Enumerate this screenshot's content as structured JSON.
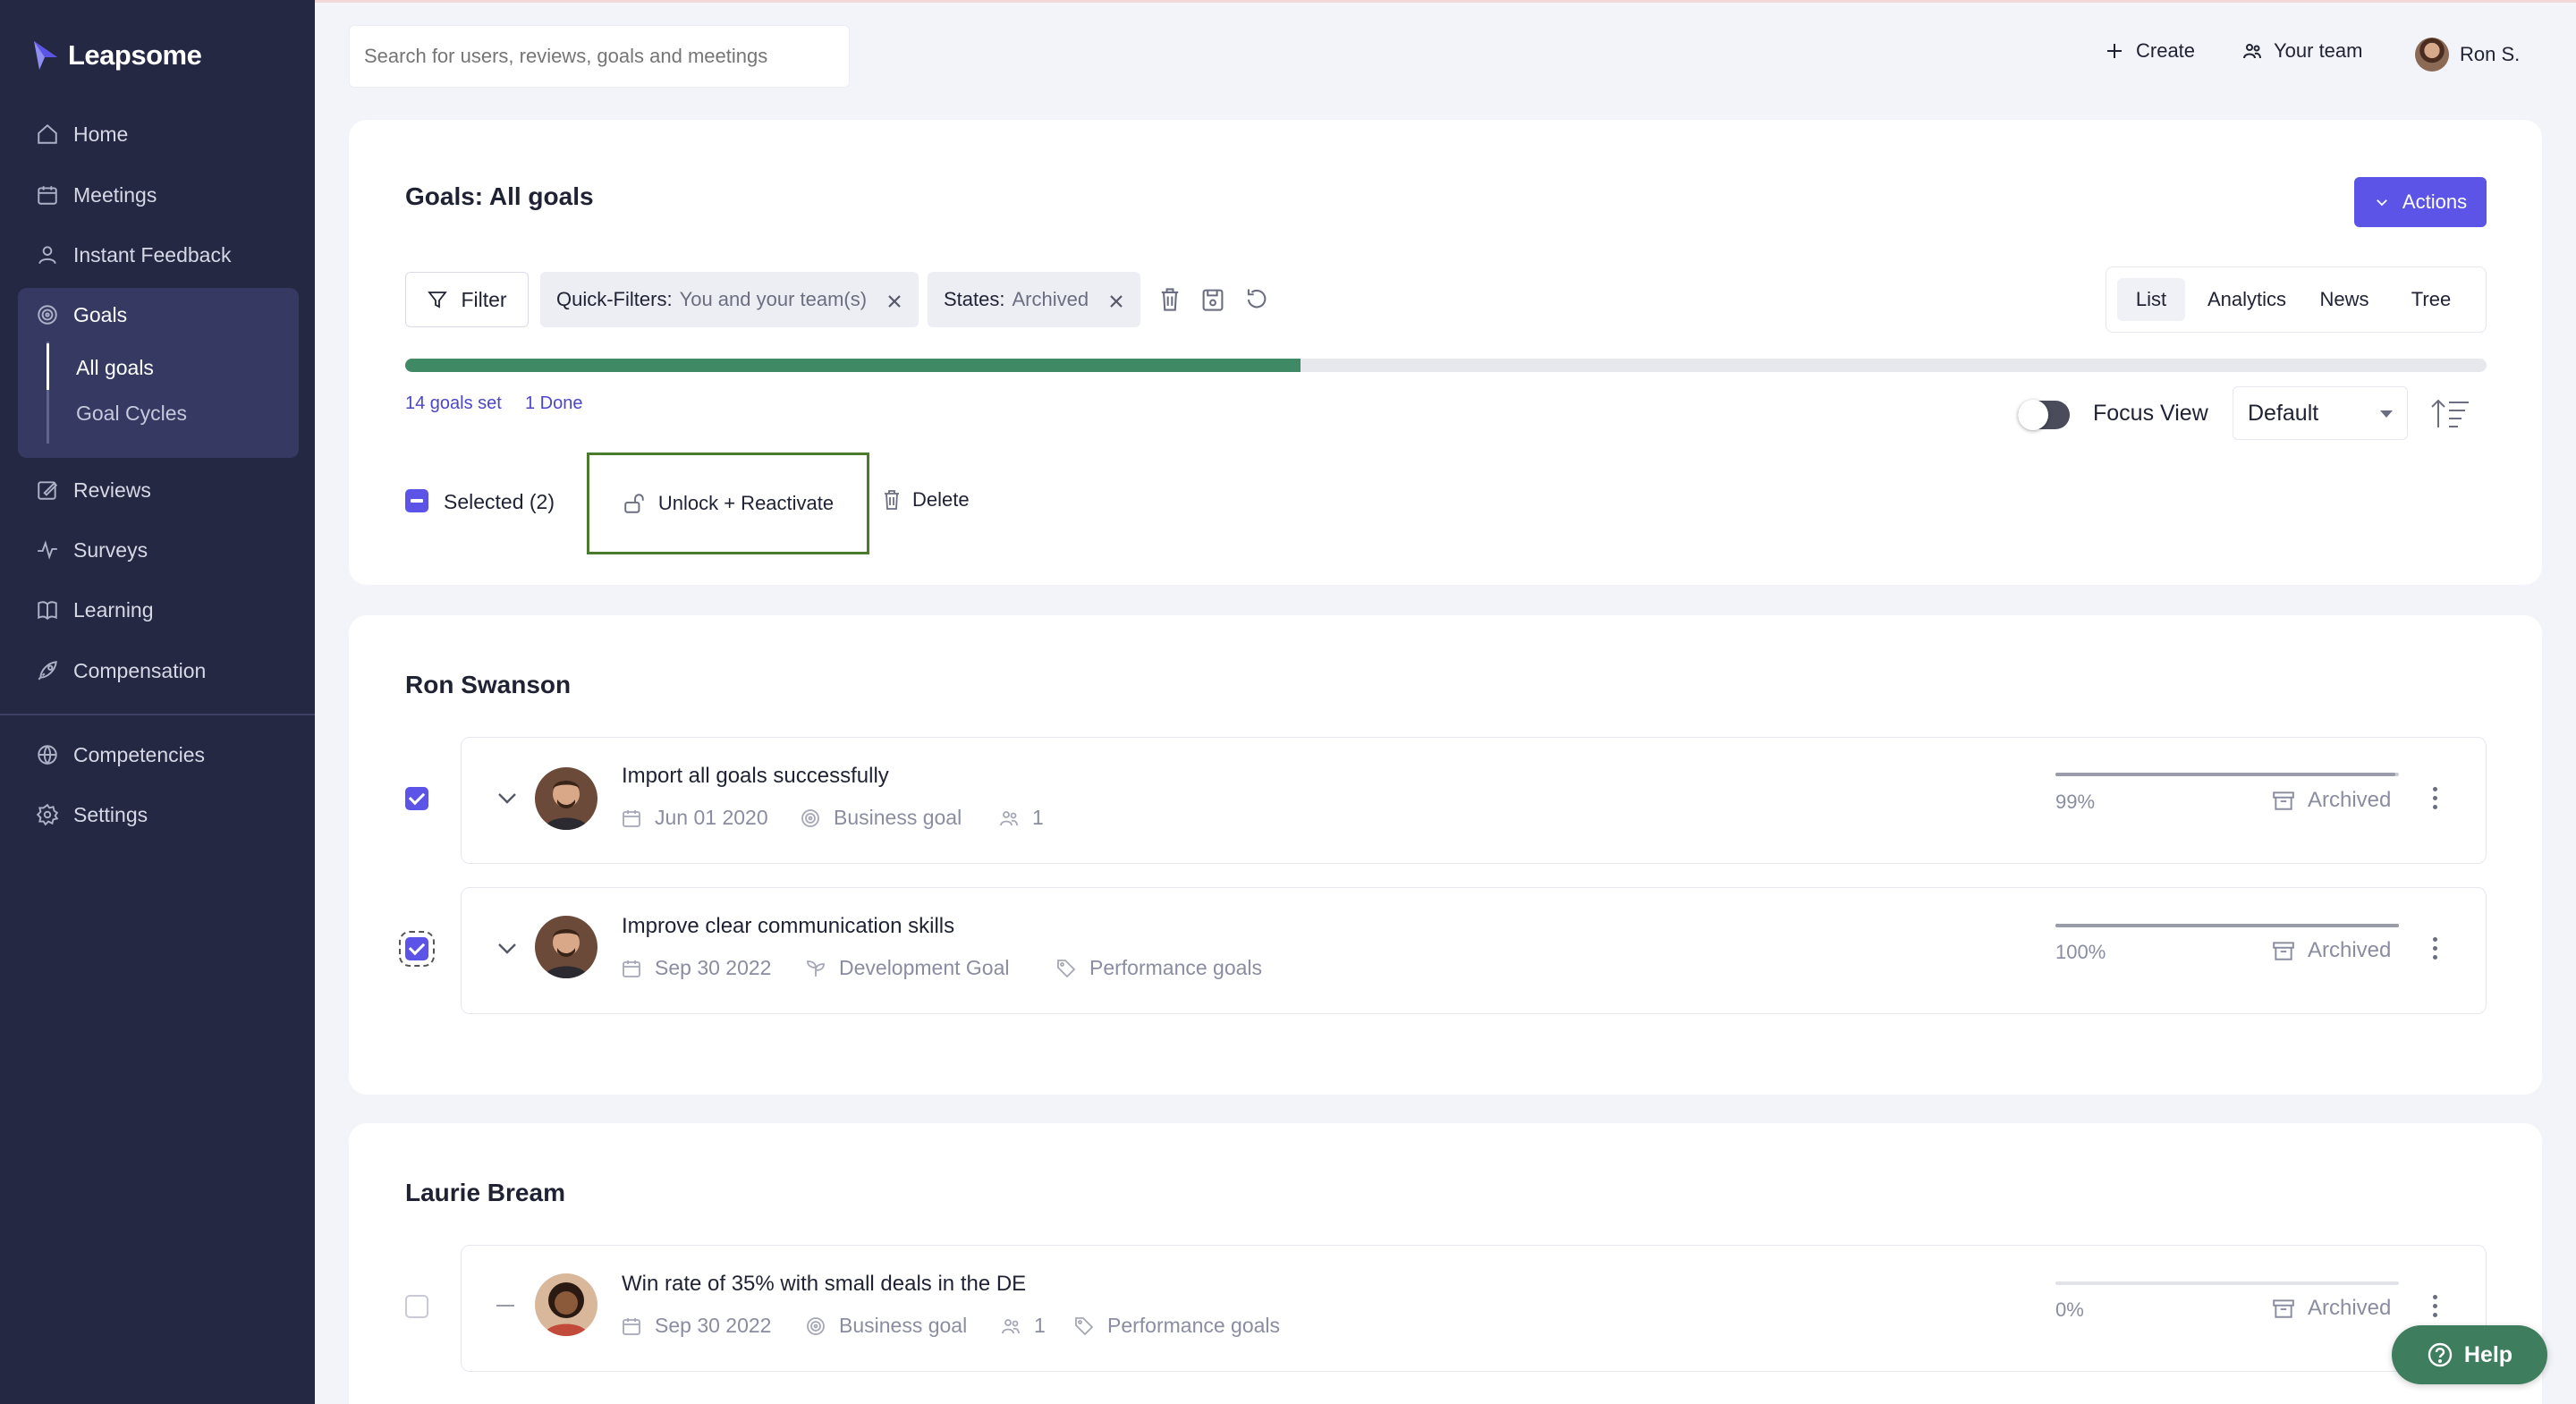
{
  "app": {
    "brand": "Leapsome",
    "accent_color": "#5b54e6",
    "sidebar_color": "#252842"
  },
  "sidebar": {
    "items": [
      {
        "label": "Home",
        "icon": "home-icon"
      },
      {
        "label": "Meetings",
        "icon": "calendar-icon"
      },
      {
        "label": "Instant Feedback",
        "icon": "feedback-icon"
      },
      {
        "label": "Goals",
        "icon": "target-icon"
      },
      {
        "label": "Reviews",
        "icon": "edit-icon"
      },
      {
        "label": "Surveys",
        "icon": "pulse-icon"
      },
      {
        "label": "Learning",
        "icon": "book-icon"
      },
      {
        "label": "Compensation",
        "icon": "rocket-icon"
      },
      {
        "label": "Competencies",
        "icon": "network-icon"
      },
      {
        "label": "Settings",
        "icon": "gear-icon"
      }
    ],
    "goals_sub": [
      {
        "label": "All goals",
        "active": true
      },
      {
        "label": "Goal Cycles",
        "active": false
      }
    ]
  },
  "topbar": {
    "search_placeholder": "Search for users, reviews, goals and meetings",
    "create_label": "Create",
    "team_label": "Your team",
    "user_label": "Ron S."
  },
  "header": {
    "title": "Goals: All goals",
    "actions_label": "Actions",
    "filter_label": "Filter",
    "chips": [
      {
        "key": "Quick-Filters:",
        "value": "You and your team(s)"
      },
      {
        "key": "States:",
        "value": "Archived"
      }
    ],
    "view_tabs": [
      "List",
      "Analytics",
      "News",
      "Tree"
    ],
    "active_tab": "List",
    "overall_progress": 0.43,
    "goals_set": "14 goals set",
    "done": "1 Done",
    "focus_view_label": "Focus View",
    "sort_value": "Default",
    "selected_label": "Selected (2)",
    "unlock_label": "Unlock + Reactivate",
    "delete_label": "Delete"
  },
  "sections": [
    {
      "name": "Ron Swanson",
      "goals": [
        {
          "title": "Import all goals successfully",
          "date": "Jun 01 2020",
          "type": "Business goal",
          "participants": "1",
          "tag": "",
          "progress_label": "99%",
          "progress": 0.99,
          "status": "Archived",
          "checked": true
        },
        {
          "title": "Improve clear communication skills",
          "date": "Sep 30 2022",
          "type": "Development Goal",
          "participants": "",
          "tag": "Performance goals",
          "progress_label": "100%",
          "progress": 1.0,
          "status": "Archived",
          "checked": true
        }
      ]
    },
    {
      "name": "Laurie Bream",
      "goals": [
        {
          "title": "Win rate of 35% with small deals in the DE",
          "date": "Sep 30 2022",
          "type": "Business goal",
          "participants": "1",
          "tag": "Performance goals",
          "progress_label": "0%",
          "progress": 0.0,
          "status": "Archived",
          "checked": false
        }
      ]
    }
  ],
  "help_label": "Help"
}
